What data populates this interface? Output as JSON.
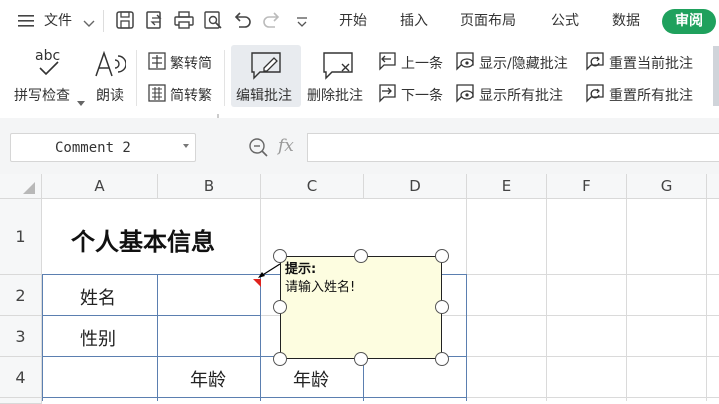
{
  "menubar": {
    "file_label": "文件",
    "tabs": [
      "开始",
      "插入",
      "页面布局",
      "公式",
      "数据"
    ],
    "active_tab": "审阅"
  },
  "ribbon": {
    "spellcheck": "拼写检查",
    "spellcheck_icon_text": "abc",
    "read_aloud": "朗读",
    "to_traditional": "繁转简",
    "to_simplified": "简转繁",
    "edit_comment": "编辑批注",
    "delete_comment": "删除批注",
    "prev": "上一条",
    "next": "下一条",
    "show_hide": "显示/隐藏批注",
    "show_all": "显示所有批注",
    "reset_current": "重置当前批注",
    "reset_all": "重置所有批注"
  },
  "formula_bar": {
    "name_box_value": "Comment 2",
    "fx_label": "fx"
  },
  "sheet": {
    "columns": [
      "A",
      "B",
      "C",
      "D",
      "E",
      "F",
      "G"
    ],
    "rows": [
      "1",
      "2",
      "3",
      "4"
    ],
    "title": "个人基本信息",
    "a2": "姓名",
    "a3": "性别",
    "b4": "年龄",
    "c4": "年龄"
  },
  "comment": {
    "title": "提示:",
    "body": "请输入姓名!"
  }
}
